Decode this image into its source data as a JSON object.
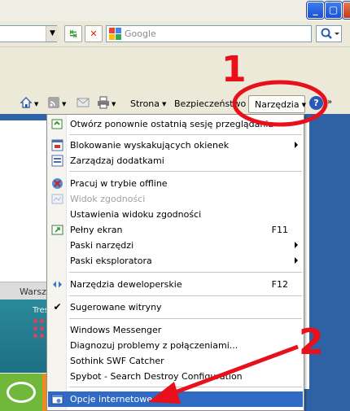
{
  "window": {
    "min_label": "_",
    "max_label": "▢",
    "close_label": "✕"
  },
  "addressbar": {
    "refresh_label": "↹",
    "stop_label": "✕",
    "search_placeholder": "Google"
  },
  "commandbar": {
    "items": [
      {
        "label": "Strona"
      },
      {
        "label": "Bezpieczeństwo"
      },
      {
        "label": "Narzędzia"
      }
    ],
    "help_label": "?"
  },
  "page": {
    "tab_label": "Warsz",
    "teaser_text": "Tres"
  },
  "menu": {
    "items": [
      {
        "label": "Otwórz ponownie ostatnią sesję przeglądania",
        "icon": "reopen-session-icon"
      },
      {
        "label": "Blokowanie wyskakujących okienek",
        "icon": "popup-blocker-icon",
        "submenu": true
      },
      {
        "label": "Zarządzaj dodatkami",
        "icon": "addons-icon"
      },
      {
        "label": "Pracuj w trybie offline",
        "icon": "offline-icon"
      },
      {
        "label": "Widok zgodności",
        "icon": "compatibility-view-icon",
        "disabled": true
      },
      {
        "label": "Ustawienia widoku zgodności"
      },
      {
        "label": "Pełny ekran",
        "icon": "fullscreen-icon",
        "shortcut": "F11"
      },
      {
        "label": "Paski narzędzi",
        "submenu": true
      },
      {
        "label": "Paski eksploratora",
        "submenu": true
      },
      {
        "label": "Narzędzia deweloperskie",
        "icon": "developer-tools-icon",
        "shortcut": "F12"
      },
      {
        "label": "Sugerowane witryny",
        "checked": true
      },
      {
        "label": "Windows Messenger"
      },
      {
        "label": "Diagnozuj problemy z połączeniami..."
      },
      {
        "label": "Sothink SWF Catcher"
      },
      {
        "label": "Spybot - Search  Destroy Configuration"
      },
      {
        "label": "Opcje internetowe",
        "icon": "internet-options-icon",
        "highlighted": true
      }
    ]
  },
  "annotations": {
    "step1": "1",
    "step2": "2",
    "color": "#e8101a"
  }
}
